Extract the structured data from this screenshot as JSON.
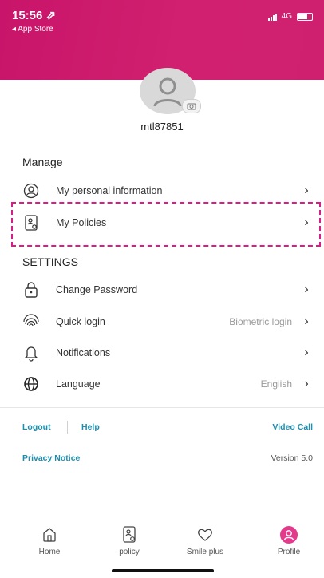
{
  "status_bar": {
    "time": "15:56 ⇗",
    "back": "◂ App Store",
    "network": "4G"
  },
  "profile": {
    "username": "mtl87851"
  },
  "manage": {
    "title": "Manage",
    "items": [
      {
        "label": "My personal information",
        "icon": "user-circle-icon"
      },
      {
        "label": "My Policies",
        "icon": "policy-document-icon"
      }
    ]
  },
  "settings": {
    "title": "SETTINGS",
    "items": [
      {
        "label": "Change Password",
        "value": "",
        "icon": "lock-icon"
      },
      {
        "label": "Quick login",
        "value": "Biometric login",
        "icon": "fingerprint-icon"
      },
      {
        "label": "Notifications",
        "value": "",
        "icon": "bell-icon"
      },
      {
        "label": "Language",
        "value": "English",
        "icon": "globe-icon"
      }
    ]
  },
  "footer_links": {
    "logout": "Logout",
    "help": "Help",
    "video_call": "Video Call",
    "privacy": "Privacy Notice",
    "version": "Version 5.0"
  },
  "tabbar": {
    "tabs": [
      {
        "label": "Home",
        "icon": "home-icon"
      },
      {
        "label": "policy",
        "icon": "policy-icon"
      },
      {
        "label": "Smile plus",
        "icon": "heart-icon"
      },
      {
        "label": "Profile",
        "icon": "profile-icon",
        "active": true
      }
    ]
  },
  "colors": {
    "brand": "#d1206f",
    "link": "#1b8fb0",
    "highlight_dash": "#e0198a"
  }
}
